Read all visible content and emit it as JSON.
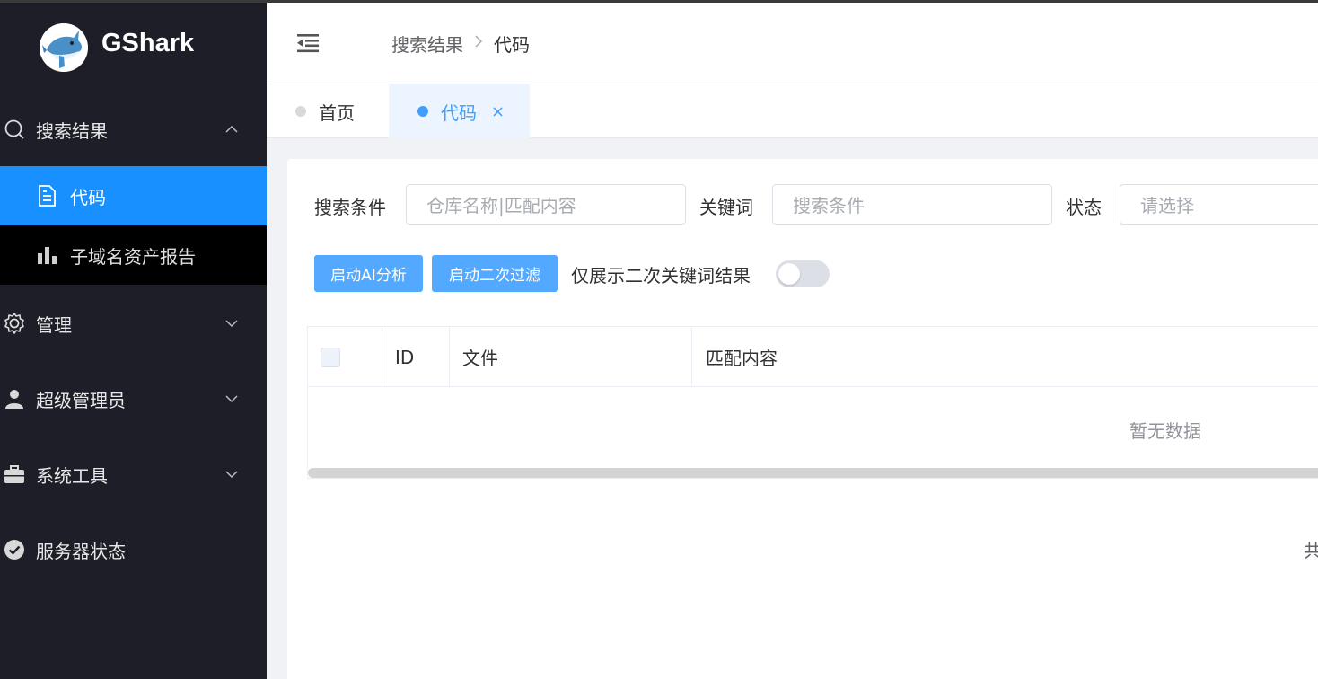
{
  "app": {
    "title": "GShark"
  },
  "sidebar": {
    "groups": [
      {
        "label": "搜索结果",
        "icon": "search-icon",
        "expanded": true
      },
      {
        "label": "管理",
        "icon": "gear-icon",
        "expanded": false
      },
      {
        "label": "超级管理员",
        "icon": "user-icon",
        "expanded": false
      },
      {
        "label": "系统工具",
        "icon": "briefcase-icon",
        "expanded": false
      },
      {
        "label": "服务器状态",
        "icon": "check-circle-icon"
      }
    ],
    "sub_items": [
      {
        "label": "代码",
        "icon": "document-icon",
        "active": true
      },
      {
        "label": "子域名资产报告",
        "icon": "bar-chart-icon",
        "active": false
      }
    ]
  },
  "header": {
    "breadcrumb": [
      "搜索结果",
      "代码"
    ]
  },
  "tabs": [
    {
      "label": "首页",
      "active": false
    },
    {
      "label": "代码",
      "active": true,
      "close": "×"
    }
  ],
  "filters": {
    "search_condition_label": "搜索条件",
    "search_condition_placeholder": "仓库名称|匹配内容",
    "keyword_label": "关键词",
    "keyword_placeholder": "搜索条件",
    "status_label": "状态",
    "status_placeholder": "请选择"
  },
  "actions": {
    "ai_analysis": "启动AI分析",
    "secondary_filter": "启动二次过滤",
    "switch_label": "仅展示二次关键词结果",
    "switch_on": false
  },
  "table": {
    "columns": [
      "ID",
      "文件",
      "匹配内容"
    ],
    "empty_text": "暂无数据"
  },
  "pagination": {
    "total_prefix": "共"
  },
  "colors": {
    "sidebar_bg": "#1d1e27",
    "active_item": "#1890ff",
    "button": "#53a8ff",
    "tab_active": "#409eff"
  }
}
